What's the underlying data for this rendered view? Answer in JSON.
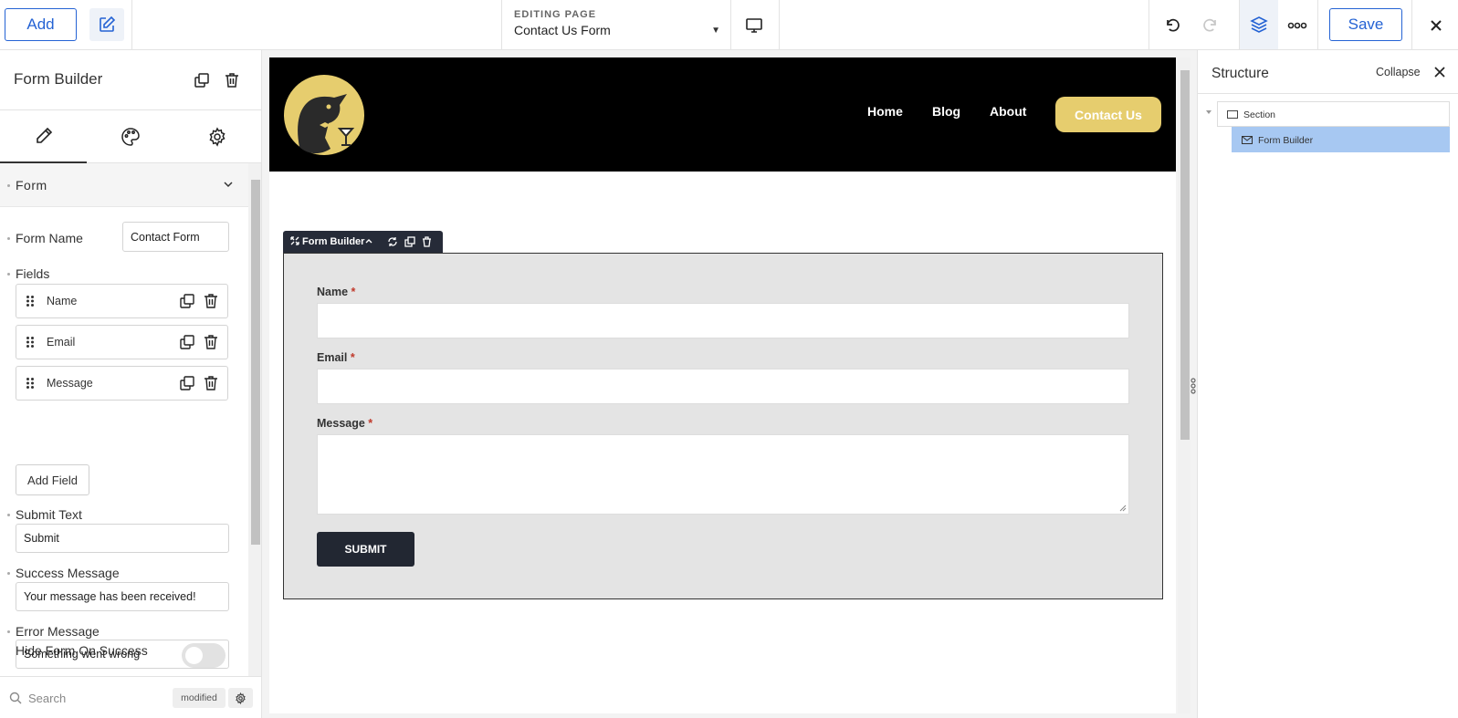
{
  "toolbar": {
    "add_label": "Add",
    "editing_label": "EDITING PAGE",
    "page_name": "Contact Us Form",
    "save_label": "Save"
  },
  "left_panel": {
    "title": "Form Builder",
    "section_title": "Form",
    "form_name_label": "Form Name",
    "form_name_value": "Contact Form",
    "fields_label": "Fields",
    "fields": [
      {
        "label": "Name"
      },
      {
        "label": "Email"
      },
      {
        "label": "Message"
      }
    ],
    "add_field_label": "Add Field",
    "submit_text_label": "Submit Text",
    "submit_text_value": "Submit",
    "success_message_label": "Success Message",
    "success_message_value": "Your message has been received!",
    "error_message_label": "Error Message",
    "error_message_value": "Something went wrong",
    "hide_form_label": "Hide Form On Success",
    "hide_form_enabled": false,
    "search_placeholder": "Search",
    "modified_badge": "modified"
  },
  "site": {
    "nav": [
      "Home",
      "Blog",
      "About"
    ],
    "cta_label": "Contact Us"
  },
  "form_preview": {
    "tag_label": "Form Builder",
    "fields": [
      {
        "label": "Name",
        "required": "*"
      },
      {
        "label": "Email",
        "required": "*"
      },
      {
        "label": "Message",
        "required": "*"
      }
    ],
    "submit_label": "SUBMIT"
  },
  "structure": {
    "title": "Structure",
    "collapse_label": "Collapse",
    "nodes": [
      {
        "label": "Section"
      },
      {
        "label": "Form Builder"
      }
    ]
  },
  "colors": {
    "accent": "#2563d4",
    "brand_gold": "#e6cd6e",
    "selected_node": "#a7c8f2",
    "header_bg": "#000000",
    "submit_bg": "#222732"
  }
}
